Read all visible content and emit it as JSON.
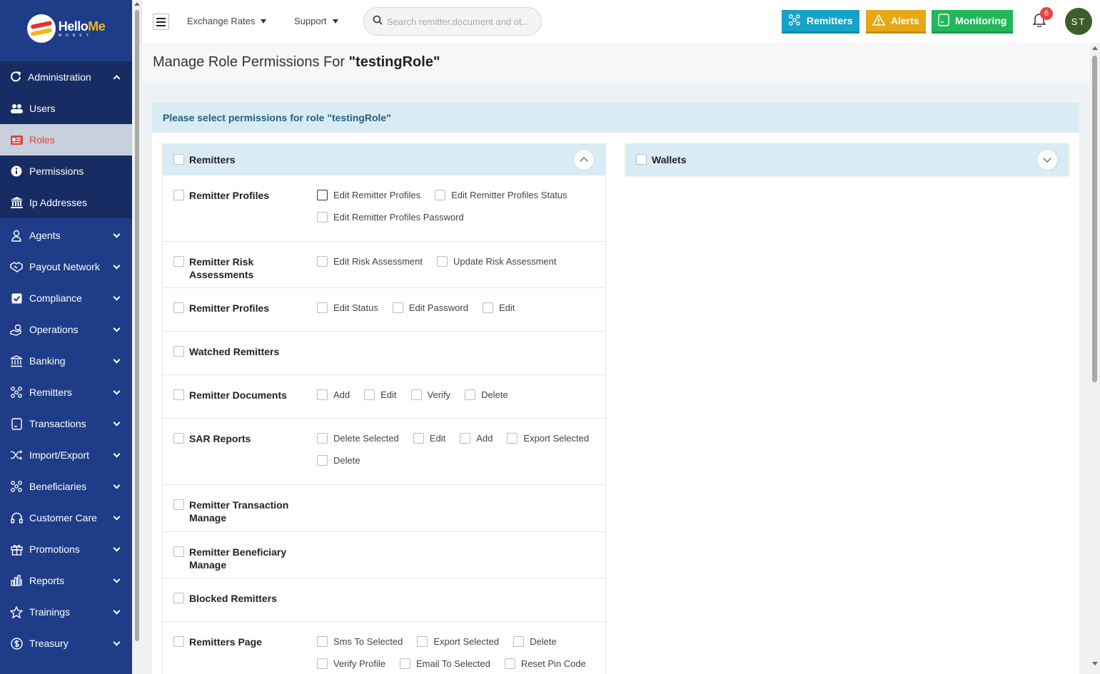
{
  "brand": {
    "name_part1": "Hello",
    "name_part2": "Me",
    "tagline": "MONEY"
  },
  "sidebar": {
    "section": {
      "label": "Administration",
      "icon": "refresh-icon"
    },
    "sub_items": [
      {
        "label": "Users",
        "icon": "users-icon",
        "active": false
      },
      {
        "label": "Roles",
        "icon": "id-card-icon",
        "active": true
      },
      {
        "label": "Permissions",
        "icon": "info-circle-icon",
        "active": false
      },
      {
        "label": "Ip Addresses",
        "icon": "bank-icon",
        "active": false
      }
    ],
    "items": [
      {
        "label": "Agents",
        "icon": "person-icon"
      },
      {
        "label": "Payout Network",
        "icon": "handshake-icon"
      },
      {
        "label": "Compliance",
        "icon": "check-square-icon"
      },
      {
        "label": "Operations",
        "icon": "hand-coins-icon"
      },
      {
        "label": "Banking",
        "icon": "bank-outline-icon"
      },
      {
        "label": "Remitters",
        "icon": "network-icon"
      },
      {
        "label": "Transactions",
        "icon": "receipt-icon"
      },
      {
        "label": "Import/Export",
        "icon": "shuffle-icon"
      },
      {
        "label": "Beneficiaries",
        "icon": "network-icon"
      },
      {
        "label": "Customer Care",
        "icon": "headset-icon"
      },
      {
        "label": "Promotions",
        "icon": "gift-icon"
      },
      {
        "label": "Reports",
        "icon": "bar-chart-icon"
      },
      {
        "label": "Trainings",
        "icon": "star-icon"
      },
      {
        "label": "Treasury",
        "icon": "dollar-circle-icon"
      }
    ]
  },
  "topbar": {
    "menu1": "Exchange Rates",
    "menu2": "Support",
    "search_placeholder": "Search remitter,document and ot...",
    "btn_remitters": "Remitters",
    "btn_alerts": "Alerts",
    "btn_monitoring": "Monitoring",
    "notification_count": "6",
    "avatar_initials": "ST",
    "colors": {
      "remitters": "#17a2c7",
      "alerts": "#e6a817",
      "monitoring": "#22b85a"
    }
  },
  "page": {
    "title_prefix": "Manage Role Permissions For ",
    "role_quoted": "\"testingRole\"",
    "instruction": "Please select permissions for role \"testingRole\""
  },
  "remitters_card": {
    "title": "Remitters",
    "rows": [
      {
        "name": "Remitter Profiles",
        "options": [
          "Edit Remitter Profiles",
          "Edit Remitter Profiles Status",
          "Edit Remitter Profiles Password"
        ]
      },
      {
        "name": "Remitter Risk Assessments",
        "options": [
          "Edit Risk Assessment",
          "Update Risk Assessment"
        ]
      },
      {
        "name": "Remitter Profiles",
        "options": [
          "Edit Status",
          "Edit Password",
          "Edit"
        ]
      },
      {
        "name": "Watched Remitters",
        "options": []
      },
      {
        "name": "Remitter Documents",
        "options": [
          "Add",
          "Edit",
          "Verify",
          "Delete"
        ]
      },
      {
        "name": "SAR Reports",
        "options": [
          "Delete Selected",
          "Edit",
          "Add",
          "Export Selected",
          "Delete"
        ]
      },
      {
        "name": "Remitter Transaction Manage",
        "options": []
      },
      {
        "name": "Remitter Beneficiary Manage",
        "options": []
      },
      {
        "name": "Blocked Remitters",
        "options": []
      },
      {
        "name": "Remitters Page",
        "options": [
          "Sms To Selected",
          "Export Selected",
          "Delete",
          "Verify Profile",
          "Email To Selected",
          "Reset Pin Code"
        ]
      }
    ]
  },
  "wallets_card": {
    "title": "Wallets"
  }
}
